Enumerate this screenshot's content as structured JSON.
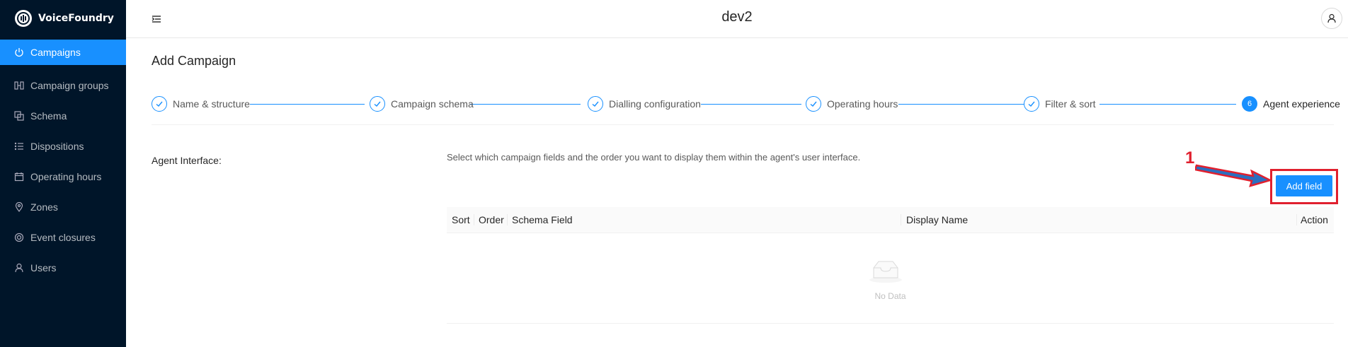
{
  "brand": {
    "name": "VoiceFoundry"
  },
  "sidebar": {
    "items": [
      {
        "label": "Campaigns",
        "icon": "power-icon",
        "active": true
      },
      {
        "label": "Campaign groups",
        "icon": "group-icon",
        "active": false
      },
      {
        "label": "Schema",
        "icon": "schema-icon",
        "active": false
      },
      {
        "label": "Dispositions",
        "icon": "list-icon",
        "active": false
      },
      {
        "label": "Operating hours",
        "icon": "calendar-icon",
        "active": false
      },
      {
        "label": "Zones",
        "icon": "location-icon",
        "active": false
      },
      {
        "label": "Event closures",
        "icon": "target-icon",
        "active": false
      },
      {
        "label": "Users",
        "icon": "user-icon",
        "active": false
      }
    ]
  },
  "header": {
    "title": "dev2"
  },
  "page": {
    "title": "Add Campaign"
  },
  "steps": [
    {
      "title": "Name & structure",
      "status": "finished"
    },
    {
      "title": "Campaign schema",
      "status": "finished"
    },
    {
      "title": "Dialling configuration",
      "status": "finished"
    },
    {
      "title": "Operating hours",
      "status": "finished"
    },
    {
      "title": "Filter & sort",
      "status": "finished"
    },
    {
      "title": "Agent experience",
      "status": "current",
      "number": "6"
    }
  ],
  "agent_interface": {
    "label": "Agent Interface:",
    "description": "Select which campaign fields and the order you want to display them within the agent's user interface.",
    "add_button": "Add field"
  },
  "annotation": {
    "number": "1"
  },
  "table": {
    "columns": [
      "Sort",
      "Order",
      "Schema Field",
      "Display Name",
      "Action"
    ],
    "empty_text": "No Data"
  },
  "colors": {
    "primary": "#1890ff",
    "sidebar_bg": "#001529",
    "annotation": "#e0202e"
  }
}
